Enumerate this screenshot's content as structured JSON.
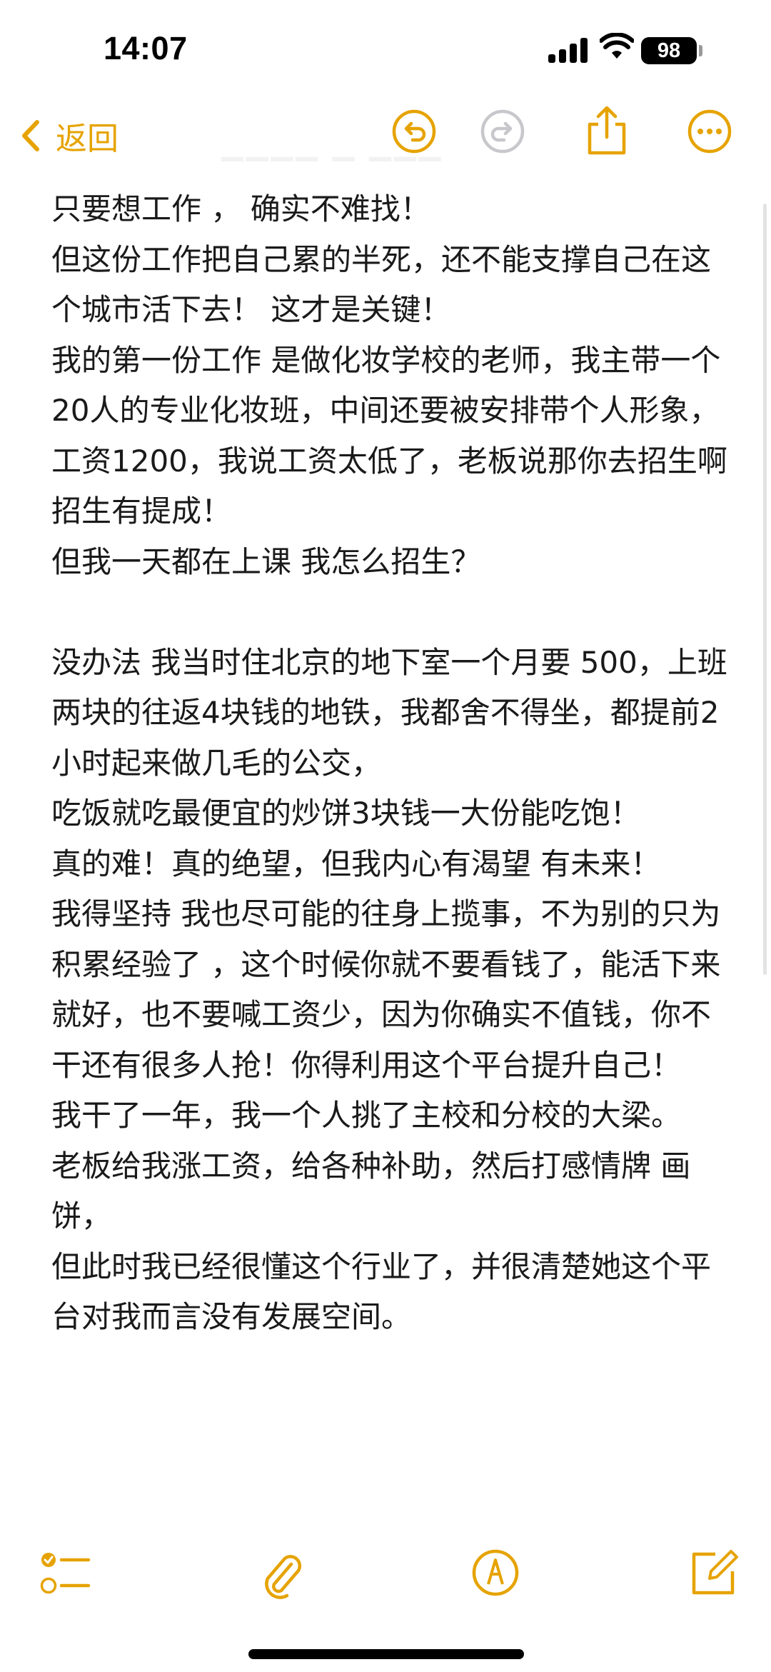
{
  "status_bar": {
    "time": "14:07",
    "battery": "98",
    "icons": [
      "signal-icon",
      "wifi-icon",
      "battery-icon"
    ]
  },
  "nav": {
    "back_label": "返回",
    "icons": [
      "undo-icon",
      "redo-icon",
      "share-icon",
      "more-icon"
    ],
    "accent_color": "#E6A300"
  },
  "note": {
    "paragraphs": [
      "只要想工作 ， 确实不难找！",
      "但这份工作把自己累的半死，还不能支撑自己在这个城市活下去！ 这才是关键！",
      "我的第一份工作 是做化妆学校的老师，我主带一个20人的专业化妆班，中间还要被安排带个人形象， 工资1200，我说工资太低了，老板说那你去招生啊 招生有提成！",
      "但我一天都在上课 我怎么招生？",
      "",
      "没办法 我当时住北京的地下室一个月要 500，上班两块的往返4块钱的地铁，我都舍不得坐，都提前2小时起来做几毛的公交，",
      "吃饭就吃最便宜的炒饼3块钱一大份能吃饱！",
      "真的难！真的绝望，但我内心有渴望 有未来！",
      "我得坚持 我也尽可能的往身上揽事，不为别的只为积累经验了 ，这个时候你就不要看钱了，能活下来就好，也不要喊工资少，因为你确实不值钱，你不干还有很多人抢！你得利用这个平台提升自己！",
      "我干了一年，我一个人挑了主校和分校的大梁。",
      "老板给我涨工资，给各种补助，然后打感情牌 画饼，",
      "但此时我已经很懂这个行业了，并很清楚她这个平台对我而言没有发展空间。"
    ]
  },
  "toolbar": {
    "icons": [
      "checklist-icon",
      "attachment-icon",
      "markup-icon",
      "compose-icon"
    ]
  }
}
